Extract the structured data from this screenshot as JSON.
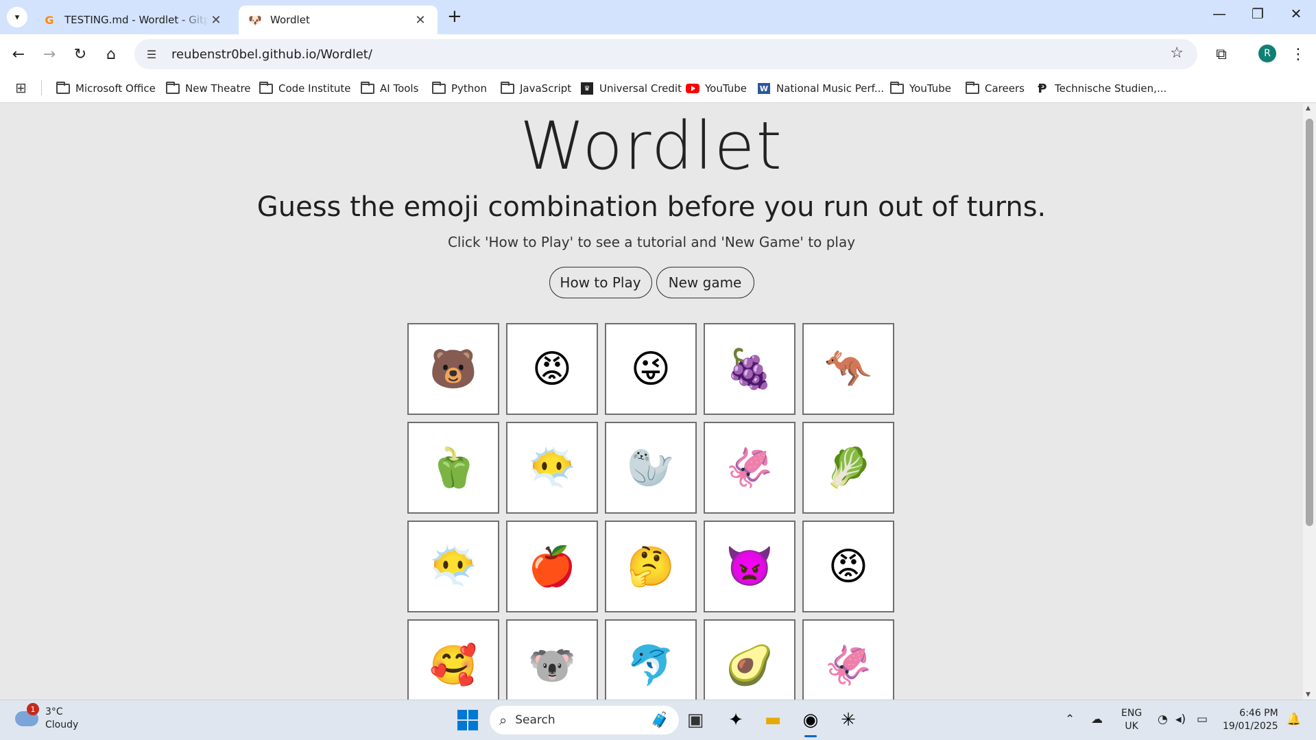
{
  "browser": {
    "tabs": [
      {
        "title": "TESTING.md - Wordlet - Gitpod",
        "favicon": "gitpod-icon",
        "active": false
      },
      {
        "title": "Wordlet",
        "favicon": "dog-icon",
        "active": true
      }
    ],
    "url": "reubenstr0bel.github.io/Wordlet/",
    "profile_initial": "R",
    "bookmarks": [
      {
        "label": "Microsoft Office",
        "icon": "folder-icon"
      },
      {
        "label": "New Theatre",
        "icon": "folder-icon"
      },
      {
        "label": "Code Institute",
        "icon": "folder-icon"
      },
      {
        "label": "AI Tools",
        "icon": "folder-icon"
      },
      {
        "label": "Python",
        "icon": "folder-icon"
      },
      {
        "label": "JavaScript",
        "icon": "folder-icon"
      },
      {
        "label": "Universal Credit",
        "icon": "universal-credit-icon"
      },
      {
        "label": "YouTube",
        "icon": "youtube-icon"
      },
      {
        "label": "National Music Perf...",
        "icon": "word-icon"
      },
      {
        "label": "YouTube",
        "icon": "folder-icon"
      },
      {
        "label": "Careers",
        "icon": "folder-icon"
      },
      {
        "label": "Technische Studien,...",
        "icon": "ts-icon"
      }
    ]
  },
  "page": {
    "title": "Wordlet",
    "subtitle": "Guess the emoji combination before you run out of turns.",
    "hint": "Click 'How to Play' to see a tutorial and 'New Game' to play",
    "how_to_play_label": "How to Play",
    "new_game_label": "New game",
    "grid": [
      [
        "🐻",
        "😡",
        "😜",
        "🍇",
        "🦘"
      ],
      [
        "🫑",
        "😶‍🌫️",
        "🦭",
        "🦑",
        "🥬"
      ],
      [
        "😶‍🌫️",
        "🍎",
        "🤔",
        "👿",
        "😡"
      ],
      [
        "🥰",
        "🐨",
        "🐬",
        "🥑",
        "🦑"
      ]
    ]
  },
  "taskbar": {
    "weather_temp": "3°C",
    "weather_desc": "Cloudy",
    "weather_badge": "1",
    "search_placeholder": "Search",
    "lang_top": "ENG",
    "lang_bottom": "UK",
    "time": "6:46 PM",
    "date": "19/01/2025"
  },
  "colors": {
    "tabbar": "#d3e3fd",
    "page_bg": "#e8e8e8",
    "cell_border": "#6e6e6e",
    "windows_blue": "#0078d4"
  }
}
